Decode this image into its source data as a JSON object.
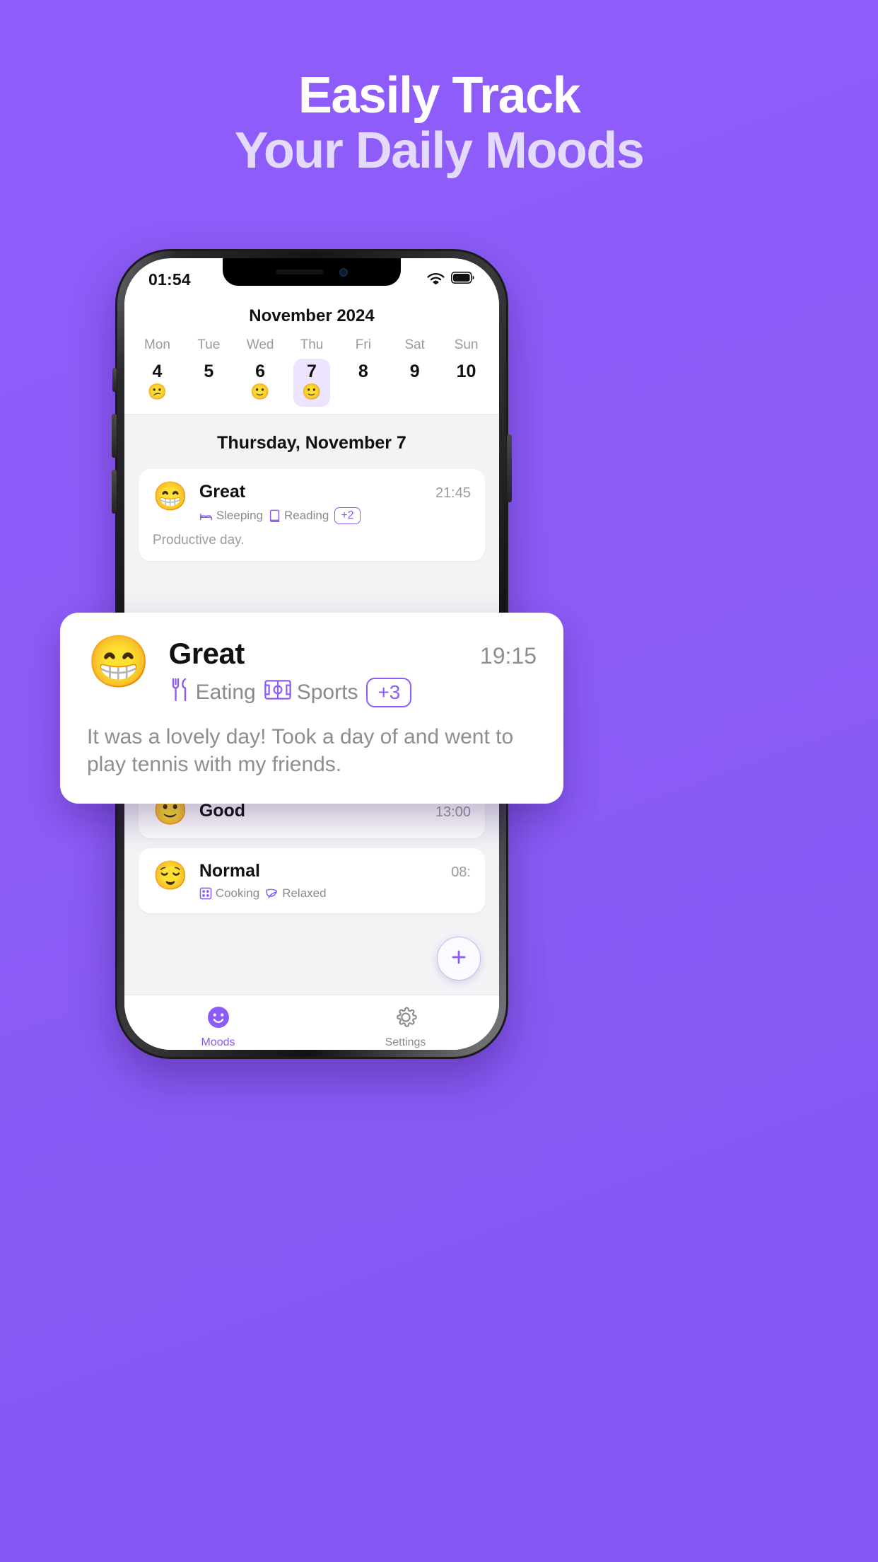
{
  "headline": {
    "line1": "Easily Track",
    "line2": "Your Daily Moods"
  },
  "colors": {
    "background": "#8B5CF6",
    "accent": "#8B5CF6",
    "headline_primary": "#FFFFFF",
    "headline_secondary": "#E3DAFC",
    "selected_day_bg": "#EDE4FD"
  },
  "status_bar": {
    "time": "01:54",
    "wifi_icon": "wifi-icon",
    "battery_icon": "battery-icon"
  },
  "calendar": {
    "title": "November 2024",
    "days": [
      {
        "dow": "Mon",
        "num": "4",
        "emoji": "😕",
        "selected": false
      },
      {
        "dow": "Tue",
        "num": "5",
        "emoji": "",
        "selected": false
      },
      {
        "dow": "Wed",
        "num": "6",
        "emoji": "🙂",
        "selected": false
      },
      {
        "dow": "Thu",
        "num": "7",
        "emoji": "🙂",
        "selected": true
      },
      {
        "dow": "Fri",
        "num": "8",
        "emoji": "",
        "selected": false
      },
      {
        "dow": "Sat",
        "num": "9",
        "emoji": "",
        "selected": false
      },
      {
        "dow": "Sun",
        "num": "10",
        "emoji": "",
        "selected": false
      }
    ]
  },
  "day_title": "Thursday, November 7",
  "entries": [
    {
      "emoji": "😁",
      "mood": "Great",
      "time": "21:45",
      "tags": [
        {
          "label": "Sleeping",
          "icon": "bed-icon"
        },
        {
          "label": "Reading",
          "icon": "book-icon"
        }
      ],
      "more_badge": "+2",
      "note": "Productive day."
    },
    {
      "emoji": "🙂",
      "mood": "Good",
      "time": "13:00",
      "tags": [],
      "more_badge": "",
      "note": ""
    },
    {
      "emoji": "😌",
      "mood": "Normal",
      "time": "08:",
      "tags": [
        {
          "label": "Cooking",
          "icon": "stove-icon"
        },
        {
          "label": "Relaxed",
          "icon": "leaf-icon"
        }
      ],
      "more_badge": "",
      "note": ""
    }
  ],
  "hero_card": {
    "emoji": "😁",
    "mood": "Great",
    "time": "19:15",
    "tags": [
      {
        "label": "Eating",
        "icon": "fork-knife-icon"
      },
      {
        "label": "Sports",
        "icon": "soccer-field-icon"
      }
    ],
    "more_badge": "+3",
    "note": "It was a lovely day! Took a day of and went to play tennis with my friends."
  },
  "fab": {
    "icon": "plus-icon",
    "label": "+"
  },
  "tabbar": {
    "tabs": [
      {
        "label": "Moods",
        "icon": "smiley-icon",
        "active": true
      },
      {
        "label": "Settings",
        "icon": "gear-icon",
        "active": false
      }
    ]
  }
}
